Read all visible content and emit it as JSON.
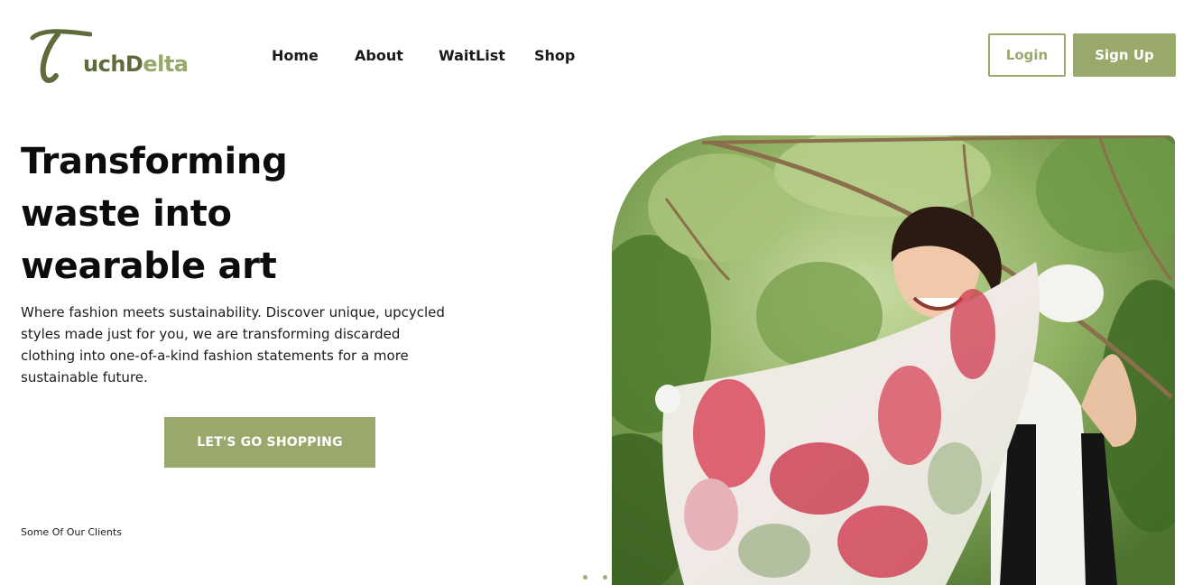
{
  "brand": {
    "initial": "T",
    "part1": "uch",
    "part2_first": "D",
    "part2_rest": "elta"
  },
  "nav": {
    "items": [
      {
        "label": "Home"
      },
      {
        "label": "About"
      },
      {
        "label": "WaitList"
      },
      {
        "label": "Shop"
      }
    ]
  },
  "auth": {
    "login_label": "Login",
    "signup_label": "Sign Up"
  },
  "hero": {
    "title_line1": "Transforming",
    "title_line2": "waste into",
    "title_line3": "wearable art",
    "subtitle": "Where fashion meets sustainability. Discover unique, upcycled styles made just for you, we are transforming discarded clothing into one-of-a-kind fashion statements for a more sustainable future.",
    "cta_label": "LET'S GO SHOPPING"
  },
  "clients": {
    "label": "Some Of Our Clients"
  },
  "carousel": {
    "count": 2
  },
  "colors": {
    "accent": "#98a96b",
    "brand_dark": "#5f6b3a"
  }
}
